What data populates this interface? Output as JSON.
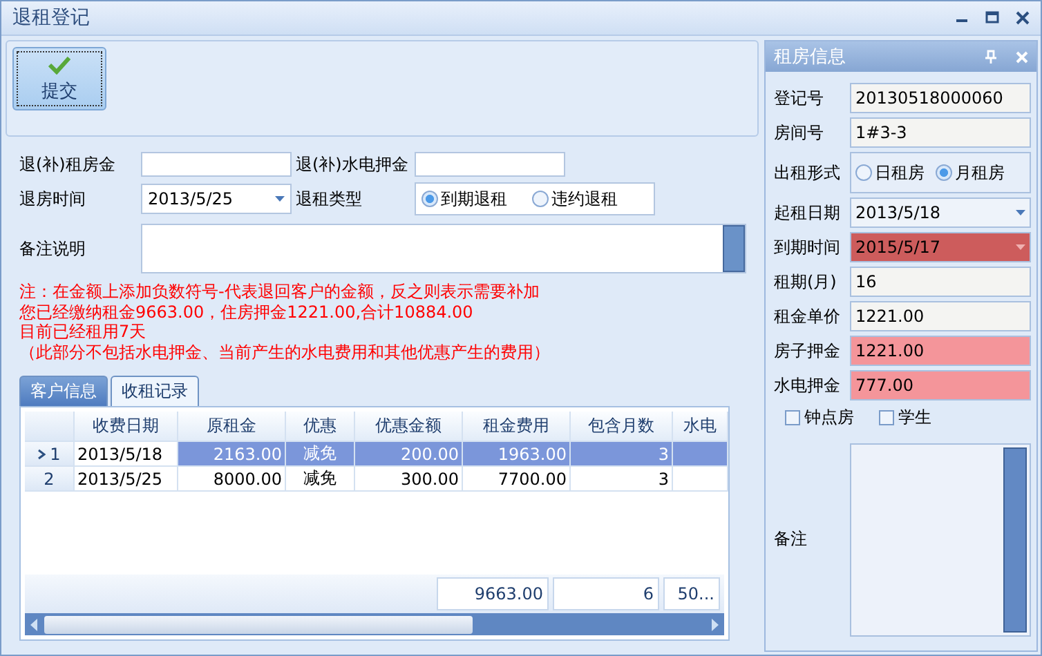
{
  "window": {
    "title": "退租登记"
  },
  "toolbar": {
    "submit": "提交"
  },
  "form": {
    "refund_rent": {
      "label": "退(补)租房金"
    },
    "refund_utility": {
      "label": "退(补)水电押金"
    },
    "checkout_date": {
      "label": "退房时间",
      "value": "2013/5/25"
    },
    "refund_type": {
      "label": "退租类型",
      "options": [
        {
          "label": "到期退租",
          "selected": true
        },
        {
          "label": "违约退租",
          "selected": false
        }
      ]
    },
    "remark": {
      "label": "备注说明"
    }
  },
  "notes": [
    "注：在金额上添加负数符号-代表退回客户的金额，反之则表示需要补加",
    "您已经缴纳租金9663.00，住房押金1221.00,合计10884.00",
    "目前已经租用7天",
    "（此部分不包括水电押金、当前产生的水电费用和其他优惠产生的费用）"
  ],
  "tabs": [
    {
      "label": "客户信息",
      "selected": false
    },
    {
      "label": "收租记录",
      "selected": true
    }
  ],
  "table": {
    "columns": [
      "收费日期",
      "原租金",
      "优惠",
      "优惠金额",
      "租金费用",
      "包含月数",
      "水电"
    ],
    "rows": [
      {
        "number": "1",
        "selected": true,
        "cells": [
          "2013/5/18",
          "2163.00",
          "减免",
          "200.00",
          "1963.00",
          "3",
          ""
        ]
      },
      {
        "number": "2",
        "selected": false,
        "cells": [
          "2013/5/25",
          "8000.00",
          "减免",
          "300.00",
          "7700.00",
          "3",
          ""
        ]
      }
    ],
    "totals": [
      "9663.00",
      "6",
      "50..."
    ]
  },
  "rental_panel": {
    "title": "租房信息",
    "fields": [
      {
        "kind": "text",
        "label": "登记号",
        "value": "20130518000060"
      },
      {
        "kind": "text",
        "label": "房间号",
        "value": "1#3-3"
      },
      {
        "kind": "radio",
        "label": "出租形式",
        "options": [
          {
            "label": "日租房",
            "selected": false
          },
          {
            "label": "月租房",
            "selected": true
          }
        ]
      },
      {
        "kind": "date",
        "label": "起租日期",
        "value": "2013/5/18"
      },
      {
        "kind": "date",
        "label": "到期时间",
        "value": "2015/5/17",
        "color": "#cd5c5c"
      },
      {
        "kind": "text",
        "label": "租期(月)",
        "value": "16"
      },
      {
        "kind": "text",
        "label": "租金单价",
        "value": "1221.00"
      },
      {
        "kind": "text",
        "label": "房子押金",
        "value": "1221.00",
        "color": "#f4959a"
      },
      {
        "kind": "text",
        "label": "水电押金",
        "value": "777.00",
        "color": "#f4959a"
      }
    ],
    "checkboxes": [
      {
        "label": "钟点房",
        "checked": false
      },
      {
        "label": "学生",
        "checked": false
      }
    ],
    "remark_label": "备注"
  }
}
